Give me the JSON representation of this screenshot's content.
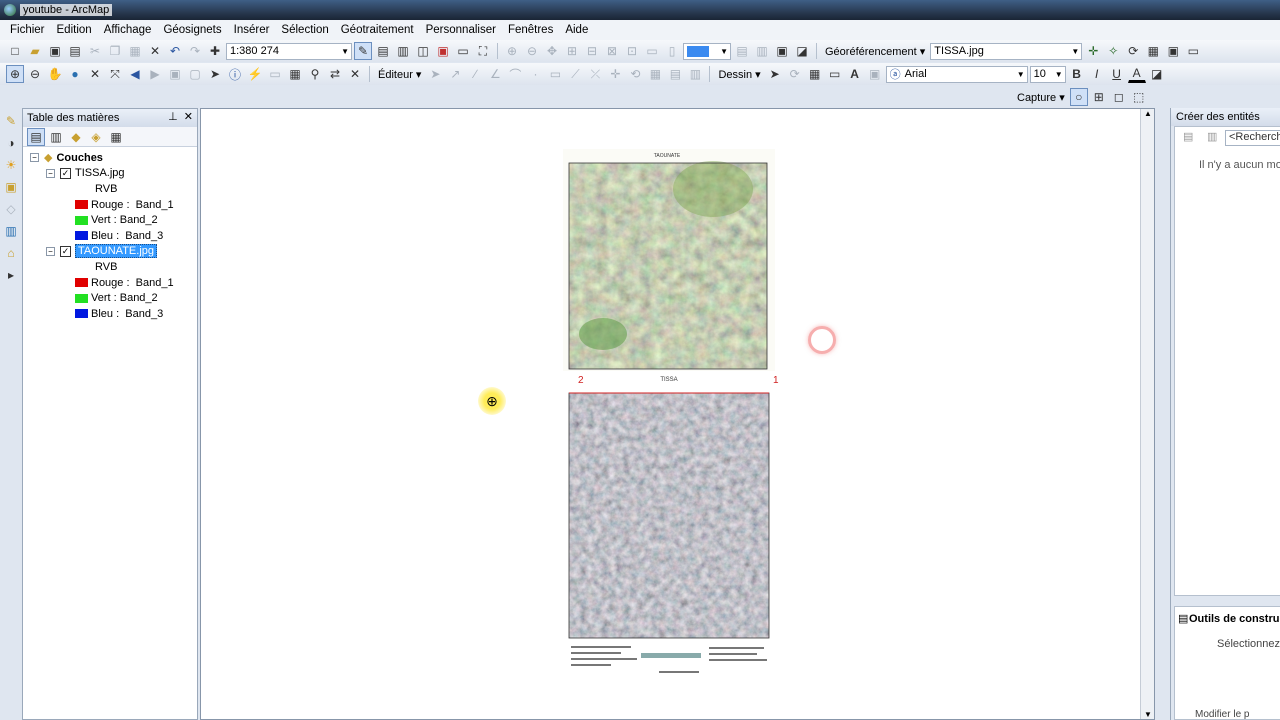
{
  "window": {
    "title": "youtube - ArcMap"
  },
  "menu": [
    "Fichier",
    "Edition",
    "Affichage",
    "Géosignets",
    "Insérer",
    "Sélection",
    "Géotraitement",
    "Personnaliser",
    "Fenêtres",
    "Aide"
  ],
  "toolbar1": {
    "scale": "1:380 274",
    "georef_label": "Géoréférencement",
    "georef_layer": "TISSA.jpg"
  },
  "toolbar2": {
    "editor_label": "Éditeur",
    "draw_label": "Dessin",
    "font_name": "Arial",
    "font_size": "10",
    "bold": "B",
    "italic": "I",
    "underline": "U",
    "font_color_glyph": "A"
  },
  "toolbar3": {
    "capture_label": "Capture"
  },
  "toc": {
    "title": "Table des matières",
    "root": "Couches",
    "layers": [
      {
        "name": "TISSA.jpg",
        "checked": true,
        "rgb": "RVB",
        "bands": [
          {
            "label": "Rouge :",
            "band": "Band_1",
            "color": "#e00000"
          },
          {
            "label": "Vert : Band_2",
            "band": "",
            "color": "#22e022"
          },
          {
            "label": "Bleu :",
            "band": "Band_3",
            "color": "#0018e0"
          }
        ]
      },
      {
        "name": "TAOUNATE.jpg",
        "checked": true,
        "rgb": "RVB",
        "bands": [
          {
            "label": "Rouge :",
            "band": "Band_1",
            "color": "#e00000"
          },
          {
            "label": "Vert : Band_2",
            "band": "",
            "color": "#22e022"
          },
          {
            "label": "Bleu :",
            "band": "Band_3",
            "color": "#0018e0"
          }
        ]
      }
    ]
  },
  "map": {
    "top_map_title": "TAOUNATE",
    "bottom_map_title": "TISSA",
    "control_point_1": "1",
    "control_point_2": "2"
  },
  "create_features": {
    "title": "Créer des entités",
    "search_placeholder": "<Recherche",
    "empty_text": "Il n'y a aucun mo",
    "construction_title": "Outils de construct",
    "construction_text": "Sélectionnez u",
    "footer_text": "Modifier le p"
  }
}
